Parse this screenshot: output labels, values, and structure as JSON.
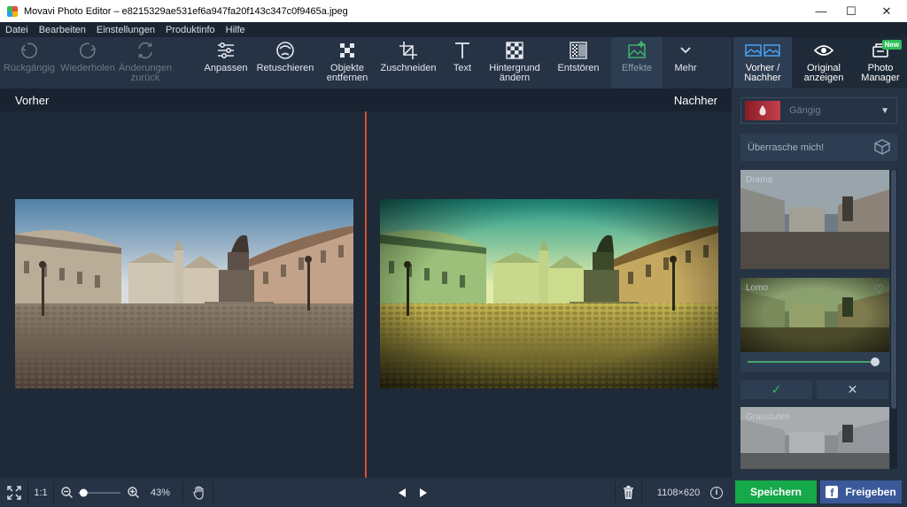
{
  "window": {
    "title": "Movavi Photo Editor – e8215329ae531ef6a947fa20f143c347c0f9465a.jpeg",
    "min_glyph": "—",
    "max_glyph": "☐",
    "close_glyph": "✕"
  },
  "menu": [
    "Datei",
    "Bearbeiten",
    "Einstellungen",
    "Produktinfo",
    "Hilfe"
  ],
  "toolbar": {
    "undo": "Rückgängig",
    "redo": "Wiederholen",
    "revert_line1": "Änderungen",
    "revert_line2": "zurück",
    "adjust": "Anpassen",
    "retouch": "Retuschieren",
    "remove_line1": "Objekte",
    "remove_line2": "entfernen",
    "crop": "Zuschneiden",
    "text": "Text",
    "bg_line1": "Hintergrund",
    "bg_line2": "ändern",
    "denoise": "Entstören",
    "effects": "Effekte",
    "more": "Mehr"
  },
  "rightbar": {
    "before_after_line1": "Vorher /",
    "before_after_line2": "Nachher",
    "original_line1": "Original",
    "original_line2": "anzeigen",
    "manager_line1": "Photo",
    "manager_line2": "Manager",
    "new_badge": "New"
  },
  "compare": {
    "before": "Vorher",
    "after": "Nachher"
  },
  "panel": {
    "category": "Gängig",
    "surprise": "Überrasche mich!",
    "effects": [
      {
        "name": "Drama"
      },
      {
        "name": "Lomo",
        "intensity": 0.97
      },
      {
        "name": "Graustufen"
      }
    ],
    "apply_glyph": "✓",
    "cancel_glyph": "✕"
  },
  "bottom": {
    "ratio": "1:1",
    "zoom": "43%",
    "zoom_value": 0.43,
    "dimensions": "1108×620",
    "info_glyph": "i",
    "save": "Speichern",
    "share": "Freigeben"
  },
  "colors": {
    "accent_green": "#16a94a",
    "facebook_blue": "#3b5998",
    "divider_red": "#d9502e"
  }
}
